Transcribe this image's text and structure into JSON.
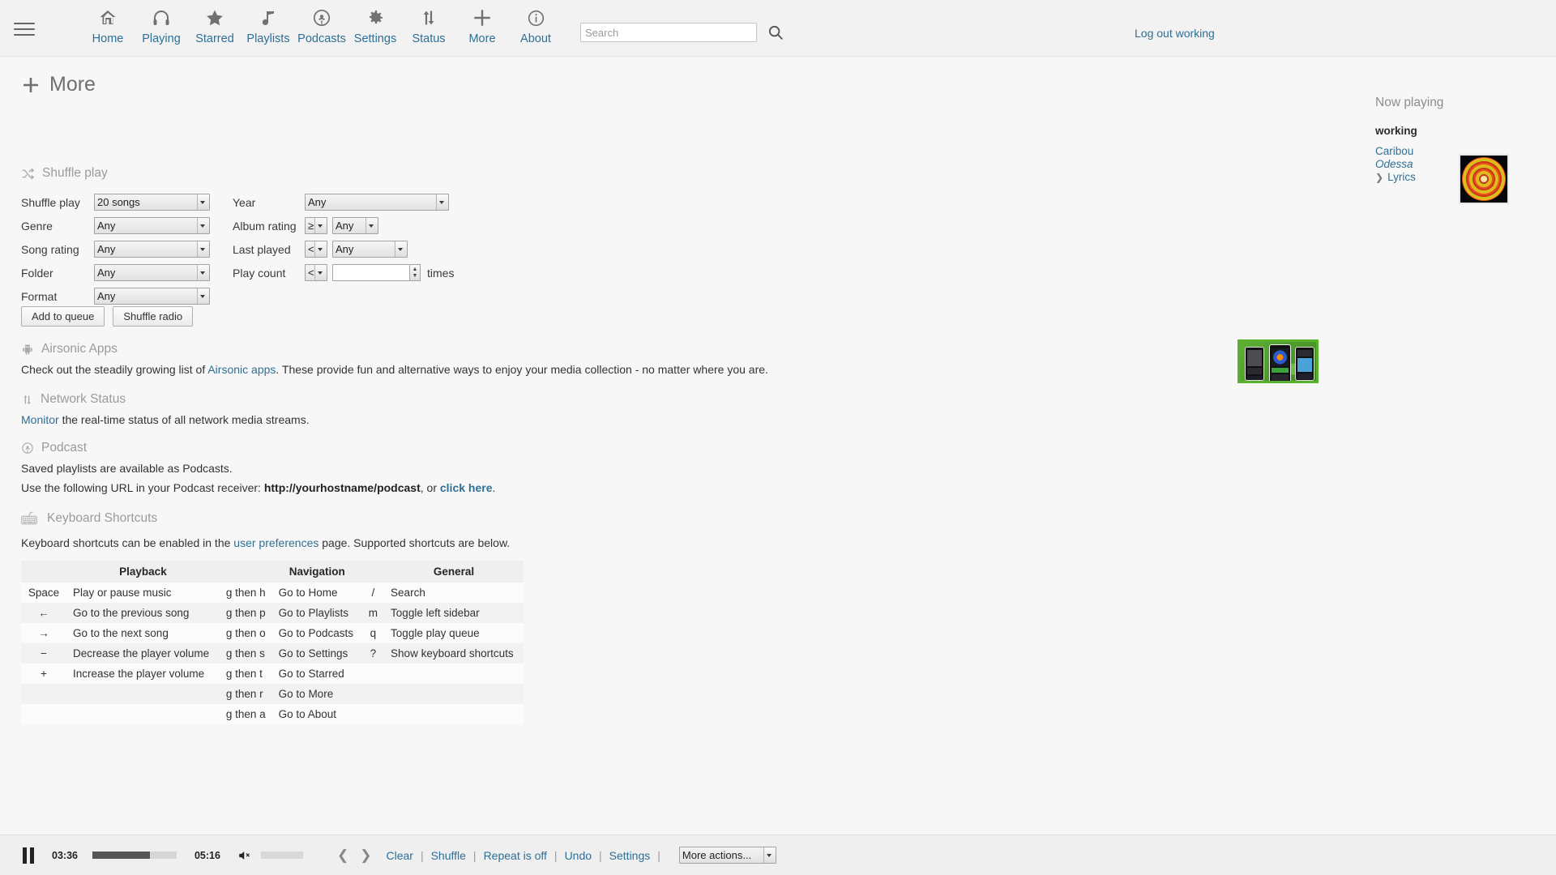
{
  "topbar": {
    "menu_icon": "hamburger-icon",
    "nav": [
      {
        "label": "Home",
        "icon": "home-icon"
      },
      {
        "label": "Playing",
        "icon": "headphones-icon"
      },
      {
        "label": "Starred",
        "icon": "star-icon"
      },
      {
        "label": "Playlists",
        "icon": "music-note-icon"
      },
      {
        "label": "Podcasts",
        "icon": "podcast-icon"
      },
      {
        "label": "Settings",
        "icon": "gear-icon"
      },
      {
        "label": "Status",
        "icon": "updown-arrows-icon"
      },
      {
        "label": "More",
        "icon": "plus-icon"
      },
      {
        "label": "About",
        "icon": "info-icon"
      }
    ],
    "search": {
      "placeholder": "Search",
      "value": "",
      "icon": "search-icon"
    },
    "logout_label": "Log out working"
  },
  "page": {
    "title": "More",
    "title_icon": "plus-icon"
  },
  "shuffle": {
    "heading": "Shuffle play",
    "heading_icon": "shuffle-icon",
    "labels": {
      "shuffle_play": "Shuffle play",
      "genre": "Genre",
      "song_rating": "Song rating",
      "folder": "Folder",
      "format": "Format",
      "year": "Year",
      "album_rating": "Album rating",
      "last_played": "Last played",
      "play_count": "Play count",
      "times": "times"
    },
    "values": {
      "shuffle_play": "20 songs",
      "genre": "Any",
      "song_rating": "Any",
      "folder": "Any",
      "format": "Any",
      "year": "Any",
      "album_rating_op": "≥",
      "album_rating": "Any",
      "last_played_op": "<",
      "last_played": "Any",
      "play_count_op": "<",
      "play_count": ""
    },
    "buttons": {
      "add_to_queue": "Add to queue",
      "shuffle_radio": "Shuffle radio"
    }
  },
  "apps": {
    "heading": "Airsonic Apps",
    "heading_icon": "android-icon",
    "text_before": "Check out the steadily growing list of ",
    "link": "Airsonic apps",
    "text_after": ". These provide fun and alternative ways to enjoy your media collection - no matter where you are."
  },
  "network": {
    "heading": "Network Status",
    "heading_icon": "updown-arrows-icon",
    "link": "Monitor",
    "text_after": " the real-time status of all network media streams."
  },
  "podcast": {
    "heading": "Podcast",
    "heading_icon": "podcast-icon",
    "line1": "Saved playlists are available as Podcasts.",
    "line2_before": "Use the following URL in your Podcast receiver: ",
    "url": "http://yourhostname/podcast",
    "line2_mid": ", or ",
    "line2_link": "click here",
    "line2_after": "."
  },
  "keyboard": {
    "heading": "Keyboard Shortcuts",
    "heading_icon": "keyboard-icon",
    "text_before": "Keyboard shortcuts can be enabled in the ",
    "link": "user preferences",
    "text_after": " page. Supported shortcuts are below.",
    "columns": [
      "",
      "Playback",
      "Navigation",
      "",
      "General"
    ],
    "headers": {
      "playback": "Playback",
      "navigation": "Navigation",
      "general": "General"
    },
    "rows": [
      {
        "pkey": "Space",
        "pdesc": "Play or pause music",
        "nkey": "g then h",
        "ndesc": "Go to Home",
        "gkey": "/",
        "gdesc": "Search"
      },
      {
        "pkey": "←",
        "pdesc": "Go to the previous song",
        "nkey": "g then p",
        "ndesc": "Go to Playlists",
        "gkey": "m",
        "gdesc": "Toggle left sidebar"
      },
      {
        "pkey": "→",
        "pdesc": "Go to the next song",
        "nkey": "g then o",
        "ndesc": "Go to Podcasts",
        "gkey": "q",
        "gdesc": "Toggle play queue"
      },
      {
        "pkey": "−",
        "pdesc": "Decrease the player volume",
        "nkey": "g then s",
        "ndesc": "Go to Settings",
        "gkey": "?",
        "gdesc": "Show keyboard shortcuts"
      },
      {
        "pkey": "+",
        "pdesc": "Increase the player volume",
        "nkey": "g then t",
        "ndesc": "Go to Starred",
        "gkey": "",
        "gdesc": ""
      },
      {
        "pkey": "",
        "pdesc": "",
        "nkey": "g then r",
        "ndesc": "Go to More",
        "gkey": "",
        "gdesc": ""
      },
      {
        "pkey": "",
        "pdesc": "",
        "nkey": "g then a",
        "ndesc": "Go to About",
        "gkey": "",
        "gdesc": ""
      }
    ]
  },
  "now_playing": {
    "title": "Now playing",
    "song": "working",
    "artist": "Caribou",
    "album": "Odessa",
    "lyrics": "Lyrics",
    "cover_alt": "album-cover"
  },
  "player": {
    "state_icon": "pause-icon",
    "elapsed": "03:36",
    "duration": "05:16",
    "progress_percent": 68,
    "volume_icon": "mute-icon",
    "prev_icon": "chevron-left-icon",
    "next_icon": "chevron-right-icon",
    "links": [
      "Clear",
      "Shuffle",
      "Repeat is off",
      "Undo",
      "Settings"
    ],
    "more_actions": "More actions..."
  },
  "colors": {
    "link": "#2e6f95",
    "muted_heading": "#9b9b9b",
    "page_bg": "#f7f7f7",
    "bar_bg": "#efefef"
  }
}
